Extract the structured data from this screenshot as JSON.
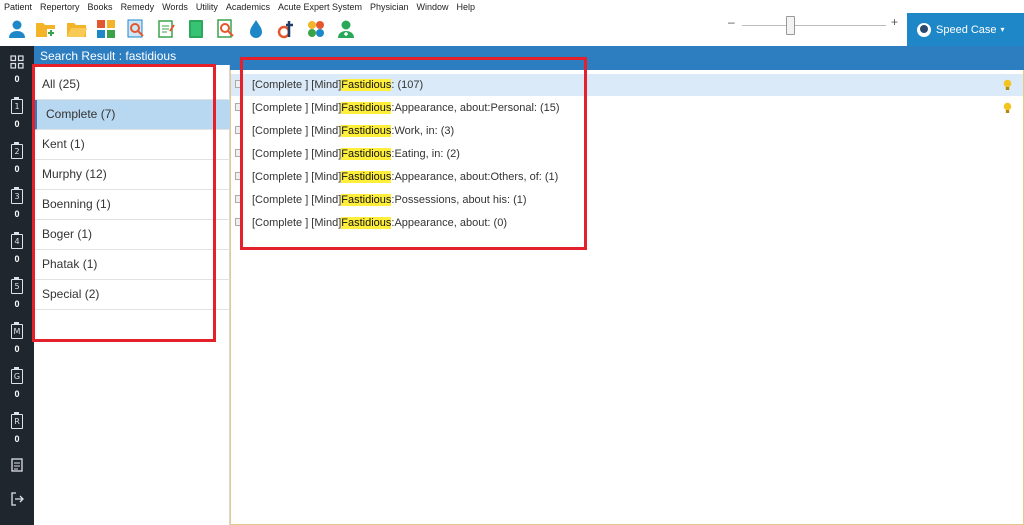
{
  "menu": [
    "Patient",
    "Repertory",
    "Books",
    "Remedy",
    "Words",
    "Utility",
    "Academics",
    "Acute Expert System",
    "Physician",
    "Window",
    "Help"
  ],
  "toolbar": {
    "icons": [
      "patient-icon",
      "new-folder-icon",
      "open-folder-icon",
      "tiles-icon",
      "search-zoom-icon",
      "notes-icon",
      "book-icon",
      "find-icon",
      "drop-icon",
      "dt-icon",
      "pattern-icon",
      "physician-icon"
    ],
    "zoom_minus": "–",
    "zoom_plus": "+",
    "speed_case_label": "Speed Case",
    "speed_case_caret": "▾"
  },
  "sidebar": {
    "top_icon": "grid-icon",
    "items": [
      {
        "glyph": "",
        "count": "0"
      },
      {
        "glyph": "1",
        "count": "0"
      },
      {
        "glyph": "2",
        "count": "0"
      },
      {
        "glyph": "3",
        "count": "0"
      },
      {
        "glyph": "4",
        "count": "0"
      },
      {
        "glyph": "5",
        "count": "0"
      },
      {
        "glyph": "M",
        "count": "0"
      },
      {
        "glyph": "G",
        "count": "0"
      },
      {
        "glyph": "R",
        "count": "0"
      }
    ],
    "bottom_icons": [
      "notes-icon",
      "exit-icon"
    ]
  },
  "search_result": {
    "title": "Search Result : fastidious",
    "items": [
      "All (25)",
      "Complete (7)",
      "Kent (1)",
      "Murphy (12)",
      "Boenning (1)",
      "Boger (1)",
      "Phatak (1)",
      "Special (2)"
    ],
    "active_index": 1
  },
  "rubrics": [
    {
      "prefix": "[Complete ] [Mind]",
      "keyword": "Fastidious",
      "rest": ": (107)",
      "highlighted": true,
      "bulb": true
    },
    {
      "prefix": "[Complete ] [Mind]",
      "keyword": "Fastidious",
      "rest": ":Appearance, about:Personal: (15)",
      "highlighted": false,
      "bulb": true
    },
    {
      "prefix": "[Complete ] [Mind]",
      "keyword": "Fastidious",
      "rest": ":Work, in: (3)",
      "highlighted": false,
      "bulb": false
    },
    {
      "prefix": "[Complete ] [Mind]",
      "keyword": "Fastidious",
      "rest": ":Eating, in: (2)",
      "highlighted": false,
      "bulb": false
    },
    {
      "prefix": "[Complete ] [Mind]",
      "keyword": "Fastidious",
      "rest": ":Appearance, about:Others, of: (1)",
      "highlighted": false,
      "bulb": false
    },
    {
      "prefix": "[Complete ] [Mind]",
      "keyword": "Fastidious",
      "rest": ":Possessions, about his: (1)",
      "highlighted": false,
      "bulb": false
    },
    {
      "prefix": "[Complete ] [Mind]",
      "keyword": "Fastidious",
      "rest": ":Appearance, about: (0)",
      "highlighted": false,
      "bulb": false
    }
  ],
  "colors": {
    "accent": "#2d7ec1",
    "sidebar": "#1f262e",
    "highlight_keyword": "#ffef3b",
    "annotation_red": "#e4202a",
    "row_highlight": "#dbeaf8"
  }
}
